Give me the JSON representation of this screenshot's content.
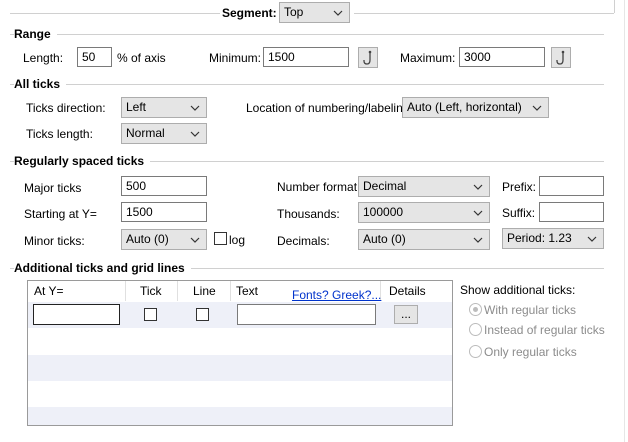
{
  "segment": {
    "label": "Segment:",
    "value": "Top"
  },
  "range": {
    "title": "Range",
    "length_label": "Length:",
    "length_value": "50",
    "length_unit": "% of axis",
    "minimum_label": "Minimum:",
    "minimum_value": "1500",
    "maximum_label": "Maximum:",
    "maximum_value": "3000"
  },
  "all_ticks": {
    "title": "All ticks",
    "direction_label": "Ticks direction:",
    "direction_value": "Left",
    "location_label": "Location of numbering/labeling:",
    "location_value": "Auto (Left, horizontal)",
    "length_label": "Ticks length:",
    "length_value": "Normal"
  },
  "regular_ticks": {
    "title": "Regularly spaced ticks",
    "major_label": "Major ticks",
    "major_value": "500",
    "starting_label": "Starting at Y=",
    "starting_value": "1500",
    "minor_label": "Minor ticks:",
    "minor_value": "Auto (0)",
    "log_label": "log",
    "number_format_label": "Number format:",
    "number_format_value": "Decimal",
    "thousands_label": "Thousands:",
    "thousands_value": "100000",
    "decimals_label": "Decimals:",
    "decimals_value": "Auto (0)",
    "prefix_label": "Prefix:",
    "prefix_value": "",
    "suffix_label": "Suffix:",
    "suffix_value": "",
    "period_value": "Period: 1.23"
  },
  "additional": {
    "title": "Additional ticks and grid lines",
    "columns": {
      "at_y": "At Y=",
      "tick": "Tick",
      "line": "Line",
      "text": "Text",
      "fonts_link": "Fonts? Greek?...",
      "details": "Details"
    },
    "row_details_button": "...",
    "show_label": "Show additional ticks:",
    "options": [
      "With regular ticks",
      "Instead of regular ticks",
      "Only regular ticks"
    ],
    "selected_option": 0
  },
  "colors": {
    "accent_link": "#0033cc",
    "stripe": "#eef0f8",
    "disabled_text": "#8c8c8c"
  }
}
